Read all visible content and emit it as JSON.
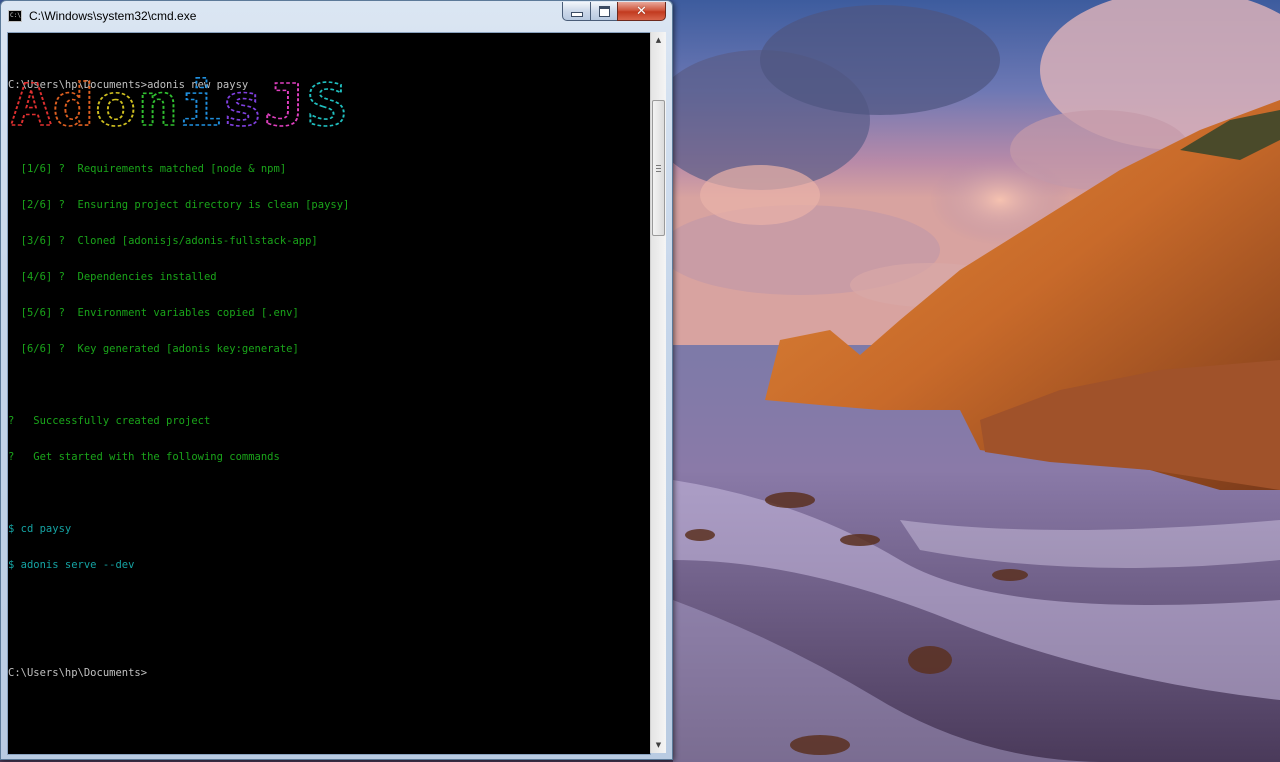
{
  "window": {
    "title": "C:\\Windows\\system32\\cmd.exe",
    "icon": "cmd-icon",
    "icon_text": "C:\\",
    "controls": {
      "minimize_icon": "minimize-icon",
      "maximize_icon": "maximize-icon",
      "close_icon": "close-icon",
      "close_glyph": "✕"
    }
  },
  "console": {
    "prompt_command": "C:\\Users\\hp\\Documents>adonis new paysy",
    "banner_text": "AdonisJS",
    "banner_colors": [
      "#e03030",
      "#e06020",
      "#d0c020",
      "#30c030",
      "#2090e0",
      "#8040e0",
      "#e040c0",
      "#20c0c0"
    ],
    "steps": [
      "  [1/6] ?  Requirements matched [node & npm]",
      "  [2/6] ?  Ensuring project directory is clean [paysy]",
      "  [3/6] ?  Cloned [adonisjs/adonis-fullstack-app]",
      "  [4/6] ?  Dependencies installed",
      "  [5/6] ?  Environment variables copied [.env]",
      "  [6/6] ?  Key generated [adonis key:generate]"
    ],
    "success": [
      "?   Successfully created project",
      "?   Get started with the following commands"
    ],
    "commands": [
      "$ cd paysy",
      "$ adonis serve --dev"
    ],
    "final_prompt": "C:\\Users\\hp\\Documents>",
    "text_colors": {
      "prompt": "#c0c0c0",
      "steps": "#1aa51a",
      "commands": "#15a3a3"
    }
  },
  "scrollbar": {
    "up_icon": "scroll-up-arrow-icon",
    "down_icon": "scroll-down-arrow-icon",
    "up_glyph": "▲",
    "down_glyph": "▼"
  },
  "desktop": {
    "wallpaper": "coastal-sunset-wallpaper"
  }
}
